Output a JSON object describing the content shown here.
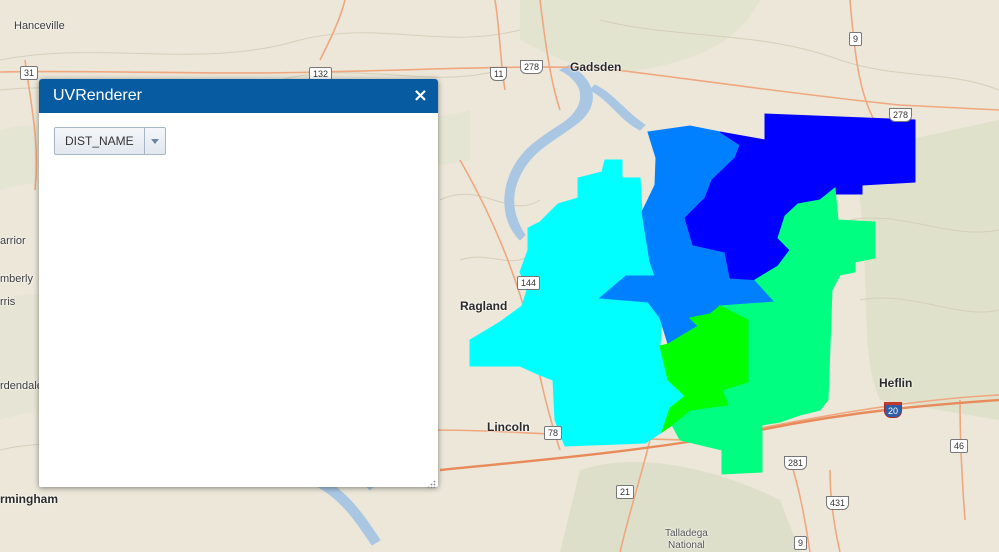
{
  "widget": {
    "title": "UVRenderer",
    "close_symbol": "×",
    "field_select": {
      "value": "DIST_NAME"
    }
  },
  "map": {
    "places": {
      "hanceville": "Hanceville",
      "gadsden": "Gadsden",
      "ragland": "Ragland",
      "lincoln": "Lincoln",
      "heflin": "Heflin",
      "birmingham": "rmingham",
      "warrior": "arrior",
      "kimberly": "mberly",
      "morris": "rris",
      "gardendale": "rdendale",
      "talladega_line1": "Talladega",
      "talladega_line2": "National"
    },
    "shields": {
      "r31": "31",
      "r132": "132",
      "r11": "11",
      "r278a": "278",
      "r9": "9",
      "r278b": "278",
      "r144": "144",
      "r78": "78",
      "r20": "20",
      "r46": "46",
      "r281": "281",
      "r21": "21",
      "r431": "431",
      "r9b": "9"
    },
    "districts": [
      {
        "color": "#0000ff"
      },
      {
        "color": "#0080ff"
      },
      {
        "color": "#00ffff"
      },
      {
        "color": "#00ff80"
      },
      {
        "color": "#00ff00"
      }
    ]
  }
}
